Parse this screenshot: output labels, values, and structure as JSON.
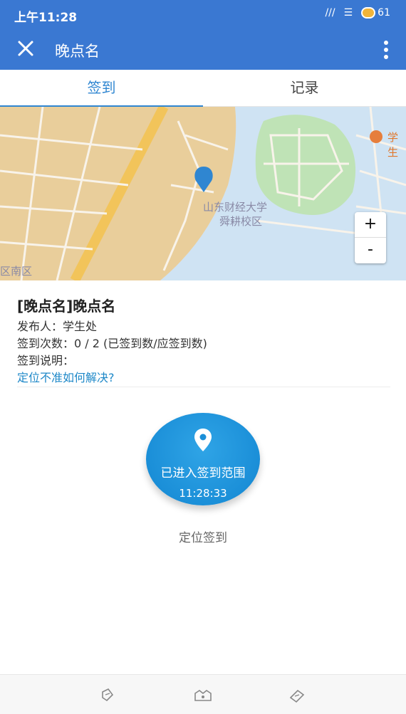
{
  "status_bar": {
    "time": "上午11:28",
    "signal_text": "///",
    "battery": "61"
  },
  "app_bar": {
    "title": "晚点名",
    "close_icon": "close-icon",
    "more_icon": "more-vert-icon"
  },
  "tabs": [
    {
      "label": "签到",
      "active": true
    },
    {
      "label": "记录",
      "active": false
    }
  ],
  "map": {
    "campus_label_1": "山东财经大学",
    "campus_label_2": "舜耕校区",
    "poi_label": "学生",
    "area_label": "区南区",
    "zoom_in": "+",
    "zoom_out": "-"
  },
  "info": {
    "name": "[晚点名]晚点名",
    "publisher": "发布人：学生处",
    "count": "签到次数：0 / 2 (已签到数/应签到数)",
    "description": "签到说明：",
    "help_link": "定位不准如何解决?"
  },
  "checkin": {
    "status": "已进入签到范围",
    "time": "11:28:33",
    "caption": "定位签到"
  },
  "colors": {
    "primary": "#3a78d2",
    "accent": "#2f86d1",
    "button": "#1b8fd8"
  },
  "bottom_nav": [
    "back-nav-icon",
    "home-nav-icon",
    "recent-nav-icon"
  ]
}
